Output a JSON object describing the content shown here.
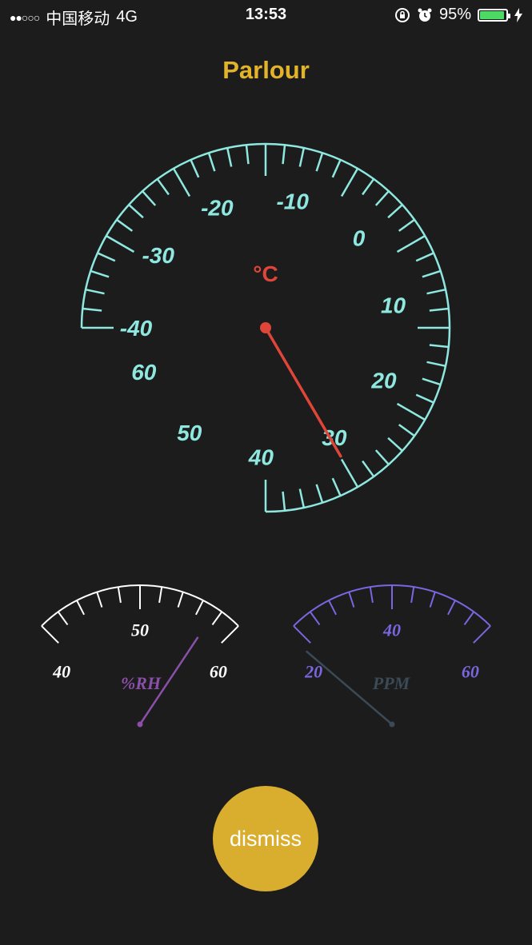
{
  "status_bar": {
    "signal": "●●○○○",
    "carrier": "中国移动",
    "network": "4G",
    "time": "13:53",
    "battery_text": "95%",
    "battery_level": 0.95,
    "icons": [
      "orientation-lock-icon",
      "alarm-icon",
      "charging-bolt-icon"
    ]
  },
  "title": "Parlour",
  "temperature_gauge": {
    "unit": "°C",
    "value": 30.5,
    "min": -40,
    "max": 60,
    "labels": [
      "-40",
      "-30",
      "-20",
      "-10",
      "0",
      "10",
      "20",
      "30",
      "40",
      "50",
      "60"
    ],
    "colors": {
      "scale": "#8fe8e0",
      "needle": "#e0453a",
      "unit": "#e0453a"
    }
  },
  "humidity_gauge": {
    "unit": "%RH",
    "value": 56,
    "labels": [
      "40",
      "50",
      "60"
    ],
    "colors": {
      "scale": "#ffffff",
      "needle": "#8a4fa8",
      "unit": "#8a4fa8"
    }
  },
  "ppm_gauge": {
    "unit": "PPM",
    "value": 10,
    "labels": [
      "20",
      "40",
      "60"
    ],
    "colors": {
      "scale": "#7a66e0",
      "needle": "#3a4a56",
      "unit": "#3a4a56"
    }
  },
  "dismiss_label": "dismiss"
}
